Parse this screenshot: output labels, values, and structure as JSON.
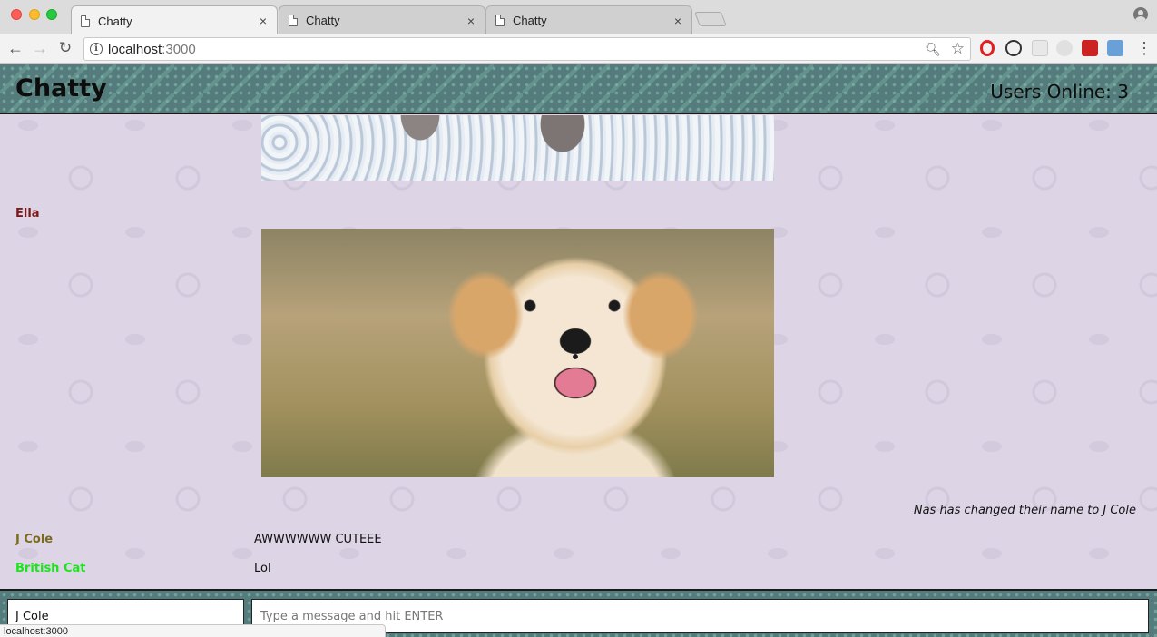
{
  "browser": {
    "tabs": [
      {
        "title": "Chatty",
        "active": true
      },
      {
        "title": "Chatty",
        "active": false
      },
      {
        "title": "Chatty",
        "active": false
      }
    ],
    "tab_close_glyph": "×",
    "url_host": "localhost",
    "url_port": ":3000",
    "status_bar_text": "localhost:3000"
  },
  "navbar": {
    "brand": "Chatty",
    "users_online": "Users Online: 3"
  },
  "messages": {
    "ella": {
      "username": "Ella",
      "color": "#7a1a1a"
    },
    "notification": "Nas has changed their name to J Cole",
    "jcole": {
      "username": "J Cole",
      "color": "#7a6a1e",
      "content": "AWWWWWW CUTEEE"
    },
    "britishcat": {
      "username": "British Cat",
      "color": "#19e619",
      "content": "Lol"
    }
  },
  "chatbar": {
    "username_value": "J Cole",
    "message_placeholder": "Type a message and hit ENTER"
  },
  "colors": {
    "navbar_bg": "#557c7c",
    "page_bg": "#ddd4e6"
  }
}
